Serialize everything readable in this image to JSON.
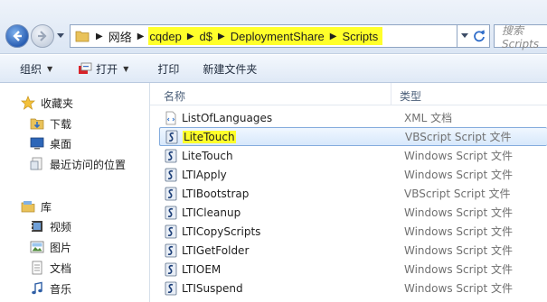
{
  "address_bar": {
    "crumbs": [
      "网络",
      "cqdep",
      "d$",
      "DeploymentShare",
      "Scripts"
    ],
    "search_placeholder": "搜索 Scripts"
  },
  "command_bar": {
    "organize": "组织",
    "open": "打开",
    "print": "打印",
    "new_folder": "新建文件夹"
  },
  "nav_pane": {
    "favorites": "收藏夹",
    "downloads": "下载",
    "desktop": "桌面",
    "recent": "最近访问的位置",
    "libraries": "库",
    "videos": "视频",
    "pictures": "图片",
    "documents": "文档",
    "music": "音乐"
  },
  "columns": {
    "name": "名称",
    "type": "类型"
  },
  "files": [
    {
      "name": "ListOfLanguages",
      "type": "XML 文档"
    },
    {
      "name": "LiteTouch",
      "type": "VBScript Script 文件"
    },
    {
      "name": "LiteTouch",
      "type": "Windows Script 文件"
    },
    {
      "name": "LTIApply",
      "type": "Windows Script 文件"
    },
    {
      "name": "LTIBootstrap",
      "type": "VBScript Script 文件"
    },
    {
      "name": "LTICleanup",
      "type": "Windows Script 文件"
    },
    {
      "name": "LTICopyScripts",
      "type": "Windows Script 文件"
    },
    {
      "name": "LTIGetFolder",
      "type": "Windows Script 文件"
    },
    {
      "name": "LTIOEM",
      "type": "Windows Script 文件"
    },
    {
      "name": "LTISuspend",
      "type": "Windows Script 文件"
    }
  ],
  "colors": {
    "highlight": "#ffff2a",
    "selection_border": "#84acdd",
    "accent": "#2a5fb3"
  }
}
